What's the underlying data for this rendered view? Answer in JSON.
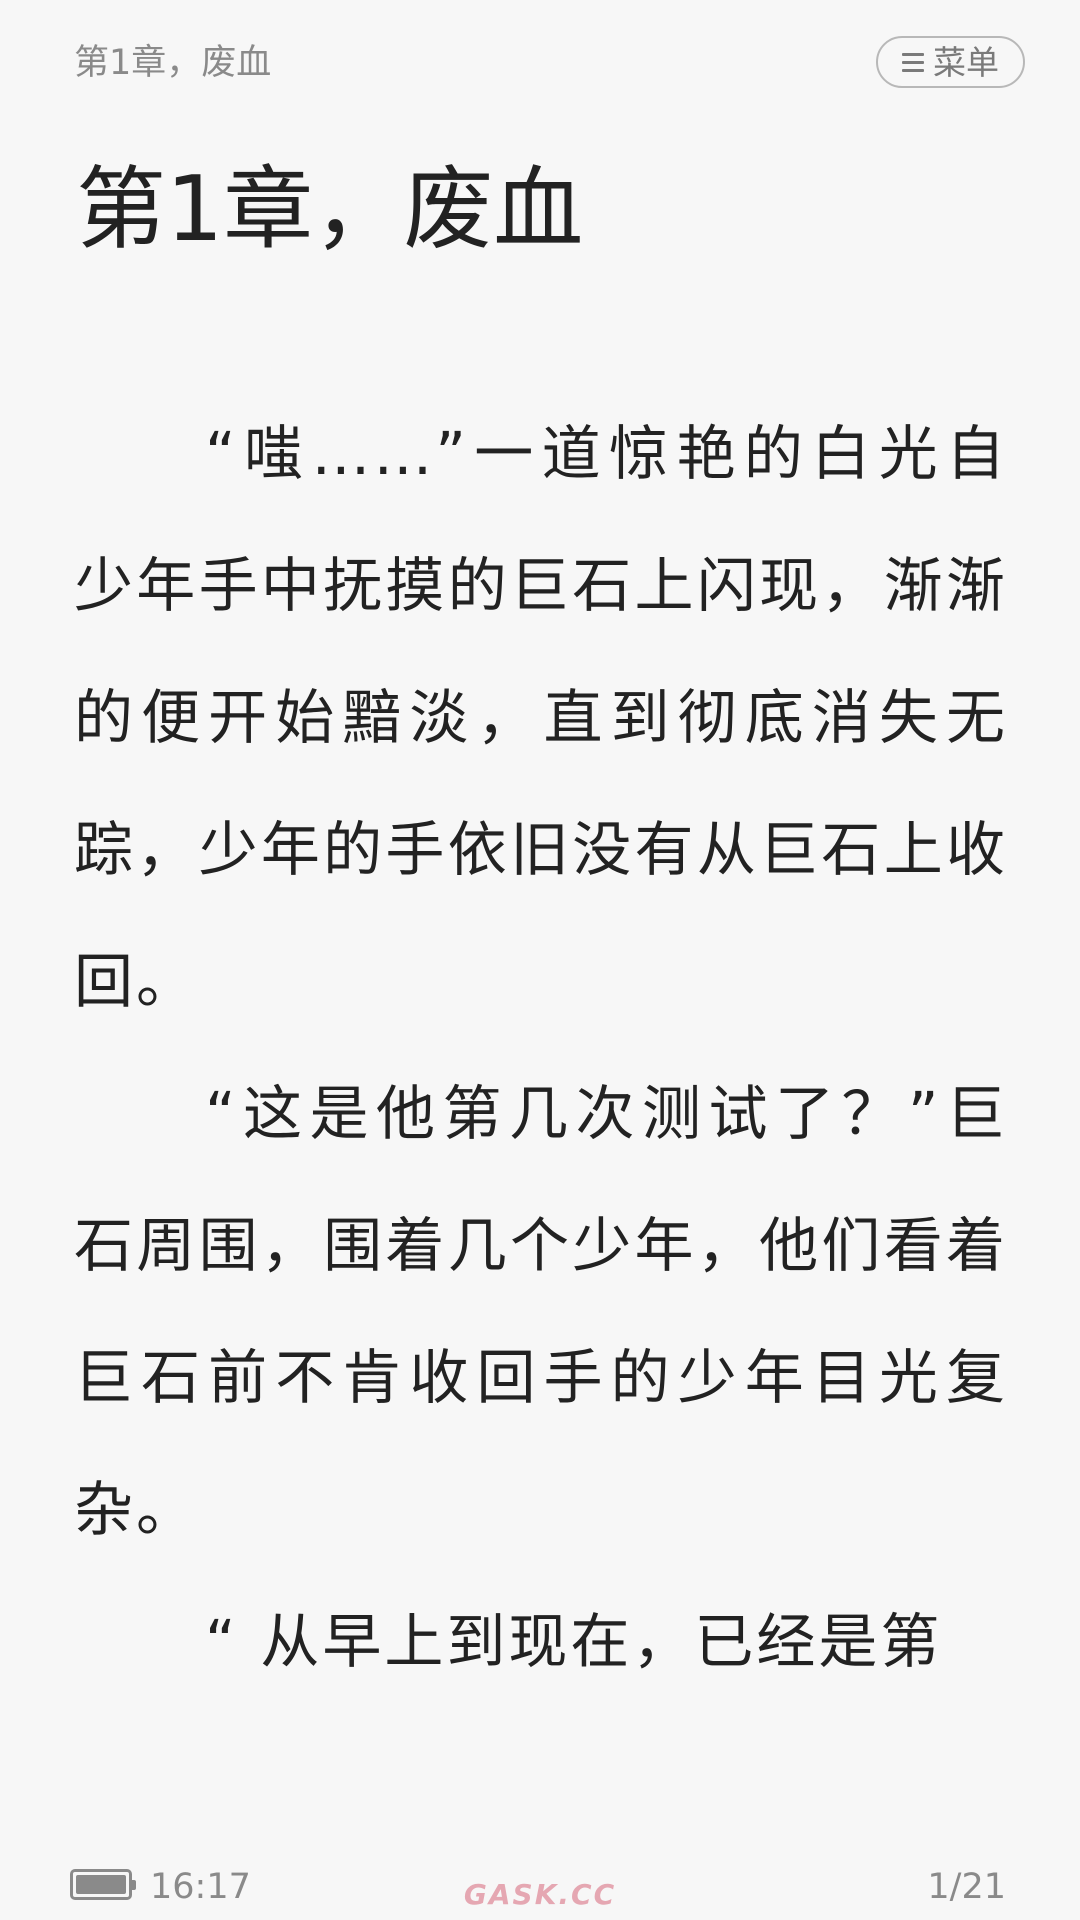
{
  "header": {
    "title": "第1章，废血",
    "menu_label": "菜单"
  },
  "chapter": {
    "title": "第1章，废血",
    "paragraphs": [
      "“嗤……”一道惊艳的白光自少年手中抚摸的巨石上闪现，渐渐的便开始黯淡，直到彻底消失无踪，少年的手依旧没有从巨石上收回。",
      "“这是他第几次测试了？”巨石周围，围着几个少年，他们看着巨石前不肯收回手的少年目光复杂。",
      "“ 从早上到现在，已经是第"
    ]
  },
  "footer": {
    "battery_level": 1.0,
    "time": "16:17",
    "watermark": "GASK.CC",
    "page": "1/21"
  },
  "colors": {
    "background": "#f7f7f7",
    "text": "#222222",
    "muted": "#8a8a8a",
    "watermark": "#e29aa6"
  }
}
